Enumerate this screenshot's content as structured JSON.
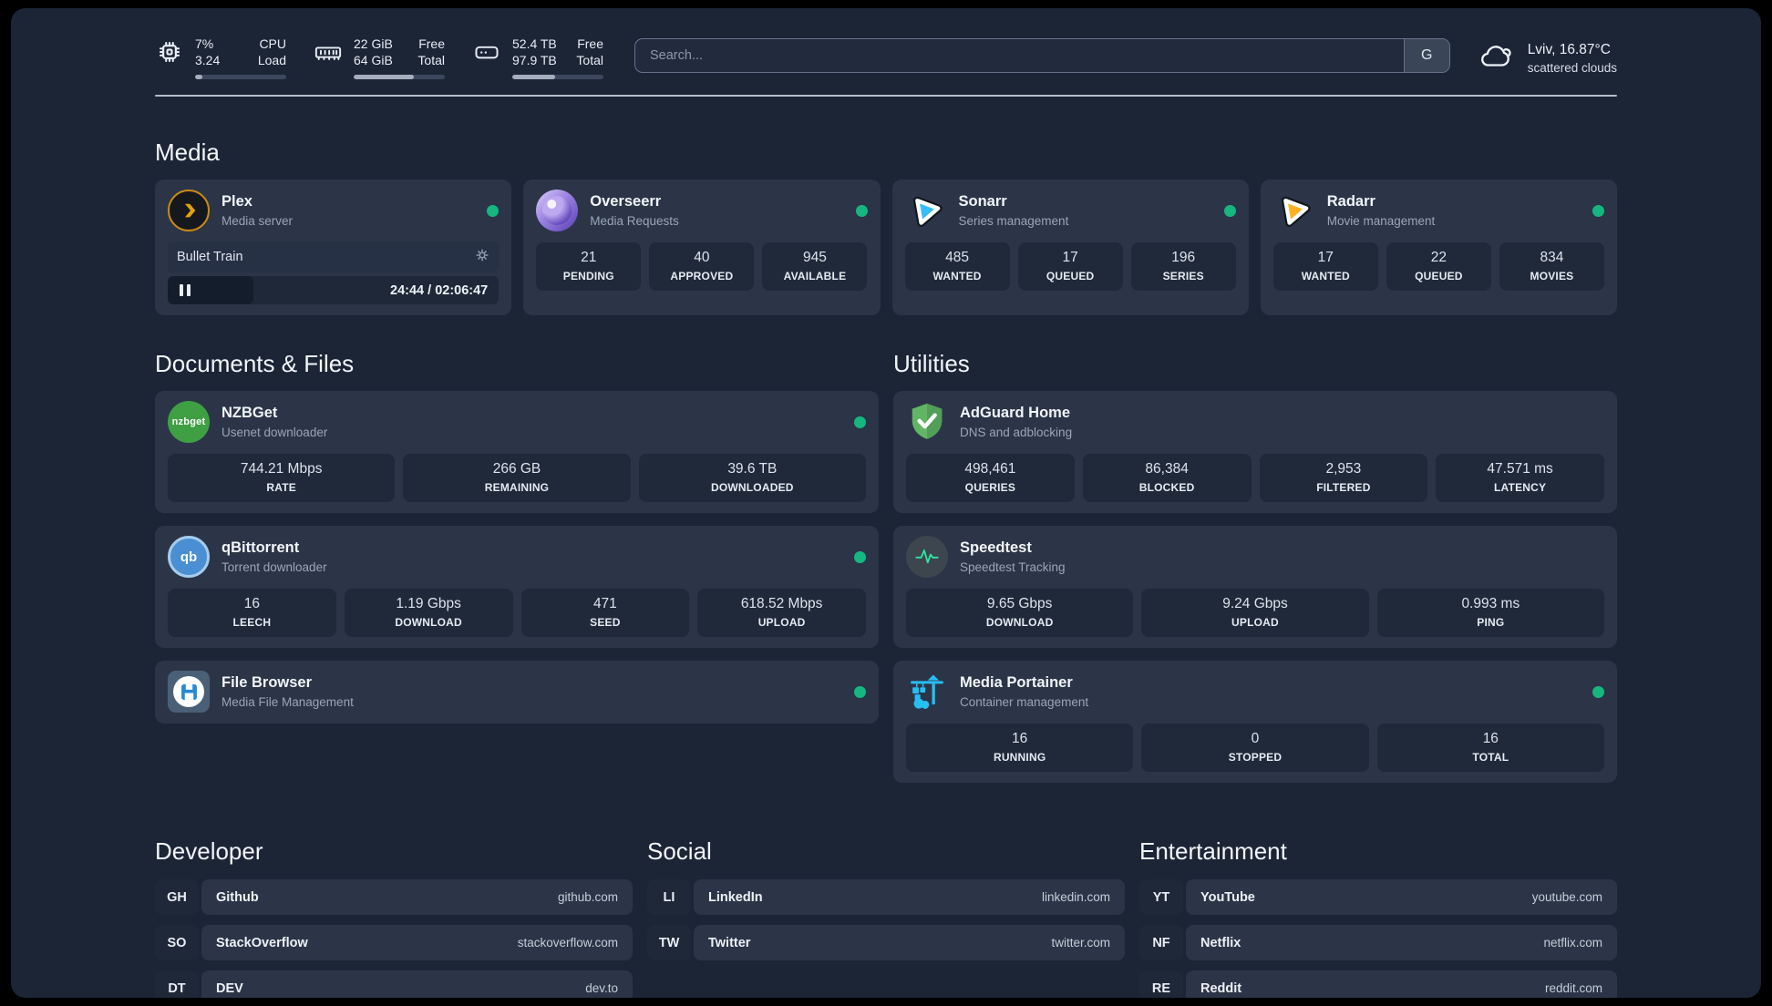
{
  "header": {
    "system_stats": [
      {
        "value_top": "7%",
        "value_bottom": "3.24",
        "label_top": "CPU",
        "label_bottom": "Load",
        "progress_pct": 8
      },
      {
        "value_top": "22 GiB",
        "value_bottom": "64 GiB",
        "label_top": "Free",
        "label_bottom": "Total",
        "progress_pct": 66
      },
      {
        "value_top": "52.4 TB",
        "value_bottom": "97.9 TB",
        "label_top": "Free",
        "label_bottom": "Total",
        "progress_pct": 47
      }
    ],
    "search": {
      "placeholder": "Search...",
      "engine_button": "G"
    },
    "weather": {
      "location_temp": "Lviv, 16.87°C",
      "condition": "scattered clouds"
    }
  },
  "sections": {
    "media": "Media",
    "documents": "Documents & Files",
    "utilities": "Utilities",
    "developer": "Developer",
    "social": "Social",
    "entertainment": "Entertainment"
  },
  "media_apps": {
    "plex": {
      "name": "Plex",
      "subtitle": "Media server",
      "status": "online",
      "now_playing": "Bullet Train",
      "time": "24:44 / 02:06:47"
    },
    "overseerr": {
      "name": "Overseerr",
      "subtitle": "Media Requests",
      "status": "online",
      "stats": [
        {
          "value": "21",
          "label": "PENDING"
        },
        {
          "value": "40",
          "label": "APPROVED"
        },
        {
          "value": "945",
          "label": "AVAILABLE"
        }
      ]
    },
    "sonarr": {
      "name": "Sonarr",
      "subtitle": "Series management",
      "status": "online",
      "stats": [
        {
          "value": "485",
          "label": "WANTED"
        },
        {
          "value": "17",
          "label": "QUEUED"
        },
        {
          "value": "196",
          "label": "SERIES"
        }
      ]
    },
    "radarr": {
      "name": "Radarr",
      "subtitle": "Movie management",
      "status": "online",
      "stats": [
        {
          "value": "17",
          "label": "WANTED"
        },
        {
          "value": "22",
          "label": "QUEUED"
        },
        {
          "value": "834",
          "label": "MOVIES"
        }
      ]
    }
  },
  "document_apps": {
    "nzbget": {
      "name": "NZBGet",
      "subtitle": "Usenet downloader",
      "status": "online",
      "icon_text": "nzbget",
      "stats": [
        {
          "value": "744.21 Mbps",
          "label": "RATE"
        },
        {
          "value": "266 GB",
          "label": "REMAINING"
        },
        {
          "value": "39.6 TB",
          "label": "DOWNLOADED"
        }
      ]
    },
    "qbittorrent": {
      "name": "qBittorrent",
      "subtitle": "Torrent downloader",
      "status": "online",
      "icon_text": "qb",
      "stats": [
        {
          "value": "16",
          "label": "LEECH"
        },
        {
          "value": "1.19 Gbps",
          "label": "DOWNLOAD"
        },
        {
          "value": "471",
          "label": "SEED"
        },
        {
          "value": "618.52 Mbps",
          "label": "UPLOAD"
        }
      ]
    },
    "filebrowser": {
      "name": "File Browser",
      "subtitle": "Media File Management",
      "status": "online"
    }
  },
  "utility_apps": {
    "adguard": {
      "name": "AdGuard Home",
      "subtitle": "DNS and adblocking",
      "stats": [
        {
          "value": "498,461",
          "label": "QUERIES"
        },
        {
          "value": "86,384",
          "label": "BLOCKED"
        },
        {
          "value": "2,953",
          "label": "FILTERED"
        },
        {
          "value": "47.571 ms",
          "label": "LATENCY"
        }
      ]
    },
    "speedtest": {
      "name": "Speedtest",
      "subtitle": "Speedtest Tracking",
      "stats": [
        {
          "value": "9.65 Gbps",
          "label": "DOWNLOAD"
        },
        {
          "value": "9.24 Gbps",
          "label": "UPLOAD"
        },
        {
          "value": "0.993 ms",
          "label": "PING"
        }
      ]
    },
    "portainer": {
      "name": "Media Portainer",
      "subtitle": "Container management",
      "status": "online",
      "stats": [
        {
          "value": "16",
          "label": "RUNNING"
        },
        {
          "value": "0",
          "label": "STOPPED"
        },
        {
          "value": "16",
          "label": "TOTAL"
        }
      ]
    }
  },
  "links": {
    "developer": [
      {
        "abbr": "GH",
        "name": "Github",
        "domain": "github.com"
      },
      {
        "abbr": "SO",
        "name": "StackOverflow",
        "domain": "stackoverflow.com"
      },
      {
        "abbr": "DT",
        "name": "DEV",
        "domain": "dev.to"
      }
    ],
    "social": [
      {
        "abbr": "LI",
        "name": "LinkedIn",
        "domain": "linkedin.com"
      },
      {
        "abbr": "TW",
        "name": "Twitter",
        "domain": "twitter.com"
      }
    ],
    "entertainment": [
      {
        "abbr": "YT",
        "name": "YouTube",
        "domain": "youtube.com"
      },
      {
        "abbr": "NF",
        "name": "Netflix",
        "domain": "netflix.com"
      },
      {
        "abbr": "RE",
        "name": "Reddit",
        "domain": "reddit.com"
      }
    ]
  },
  "colors": {
    "background": "#1c2536",
    "card": "#2b3547",
    "tile": "#1f2939",
    "status_online": "#15b77f",
    "plex_orange": "#e5a00d",
    "overseerr_purple": "#7b5fd0",
    "sonarr_blue": "#38bdf8",
    "radarr_amber": "#ffb020",
    "nzbget_green": "#3f9f43",
    "qbittorrent_blue": "#4a8fd3",
    "adguard_green": "#62b565",
    "speedtest_pulse": "#2ee59d",
    "filebrowser_blue": "#2589d6",
    "portainer_blue": "#27bef3"
  }
}
